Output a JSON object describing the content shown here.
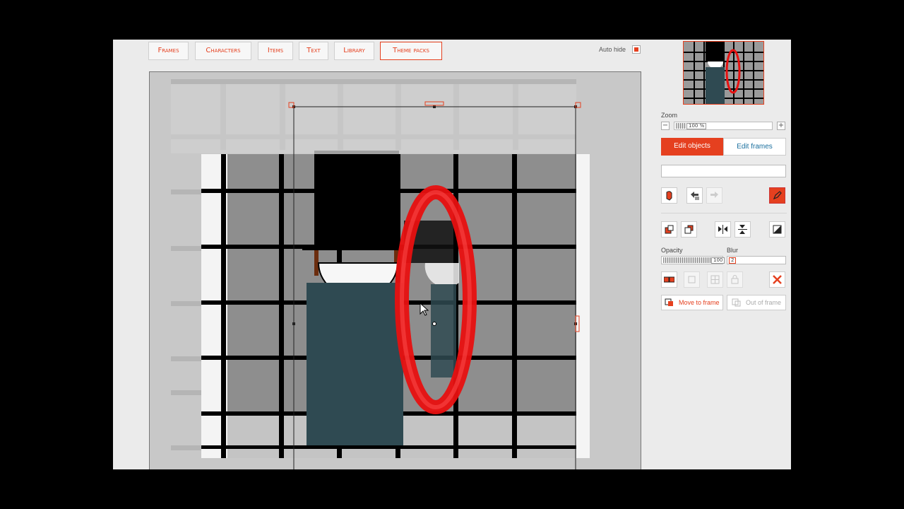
{
  "tabs": [
    {
      "label": "Frames",
      "active": false
    },
    {
      "label": "Characters",
      "active": false
    },
    {
      "label": "Items",
      "active": false
    },
    {
      "label": "Text",
      "active": false
    },
    {
      "label": "Library",
      "active": false
    },
    {
      "label": "Theme packs",
      "active": true
    }
  ],
  "autohide": {
    "label": "Auto hide",
    "checked": true
  },
  "zoom": {
    "label": "Zoom",
    "value": "100 %"
  },
  "modes": {
    "edit_objects": "Edit objects",
    "edit_frames": "Edit frames",
    "active": "edit_objects"
  },
  "name_field": {
    "value": ""
  },
  "opacity": {
    "label": "Opacity",
    "value": "100"
  },
  "blur": {
    "label": "Blur",
    "value": "2"
  },
  "actions": {
    "move_to_frame": "Move to frame",
    "out_of_frame": "Out of frame"
  },
  "colors": {
    "accent": "#e5401f",
    "panel_bg": "#ebebeb",
    "character_body": "#2f4a52",
    "ring": "#e81010"
  },
  "icons": [
    "puppet-icon",
    "undo-icon",
    "redo-icon",
    "edit-pen-icon",
    "bring-forward-icon",
    "send-backward-icon",
    "flip-horizontal-icon",
    "flip-vertical-icon",
    "invert-icon",
    "group-icon",
    "ungroup-icon",
    "align-icon",
    "lock-icon",
    "delete-icon"
  ]
}
